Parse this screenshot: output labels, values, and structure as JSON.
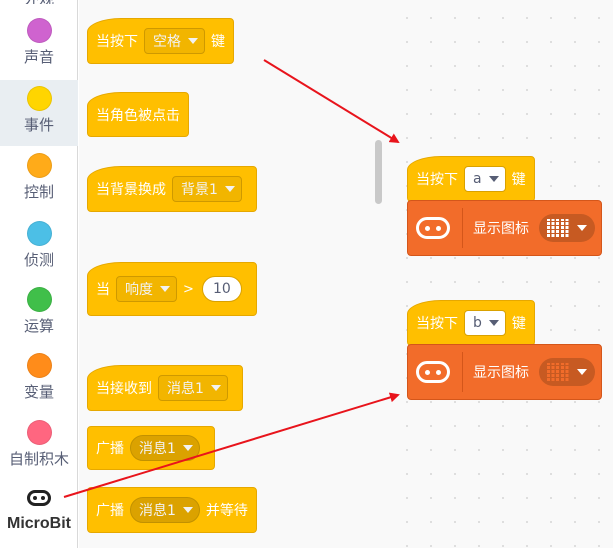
{
  "sidebar": {
    "top_partial_label": "外观",
    "categories": [
      {
        "label": "声音",
        "color": "#cf63cf"
      },
      {
        "label": "事件",
        "color": "#ffd500",
        "selected": true
      },
      {
        "label": "控制",
        "color": "#ffab19"
      },
      {
        "label": "侦测",
        "color": "#4cbfe6"
      },
      {
        "label": "运算",
        "color": "#40bf4a"
      },
      {
        "label": "变量",
        "color": "#ff8c1a"
      },
      {
        "label": "自制积木",
        "color": "#ff6680"
      },
      {
        "label": "MicroBit",
        "icon": "microbit-icon"
      }
    ]
  },
  "palette": {
    "key_press": {
      "prefix": "当按下",
      "key": "空格",
      "suffix": "键"
    },
    "sprite_clicked": "当角色被点击",
    "backdrop_switch": {
      "prefix": "当背景换成",
      "value": "背景1"
    },
    "loudness": {
      "prefix": "当",
      "sensor": "响度",
      "operator": ">",
      "value": "10"
    },
    "receive": {
      "prefix": "当接收到",
      "message": "消息1"
    },
    "broadcast": {
      "prefix": "广播",
      "message": "消息1"
    },
    "broadcast_wait": {
      "prefix": "广播",
      "message": "消息1",
      "suffix": "并等待"
    }
  },
  "workspace": {
    "script_a": {
      "prefix": "当按下",
      "key": "a",
      "suffix": "键",
      "action": "显示图标",
      "icon": "led-grid-icon"
    },
    "script_b": {
      "prefix": "当按下",
      "key": "b",
      "suffix": "键",
      "action": "显示图标",
      "icon": "led-grid-icon"
    }
  },
  "colors": {
    "event_block": "#ffbf00",
    "microbit_block": "#f26c2a",
    "arrow": "#e8141c"
  }
}
